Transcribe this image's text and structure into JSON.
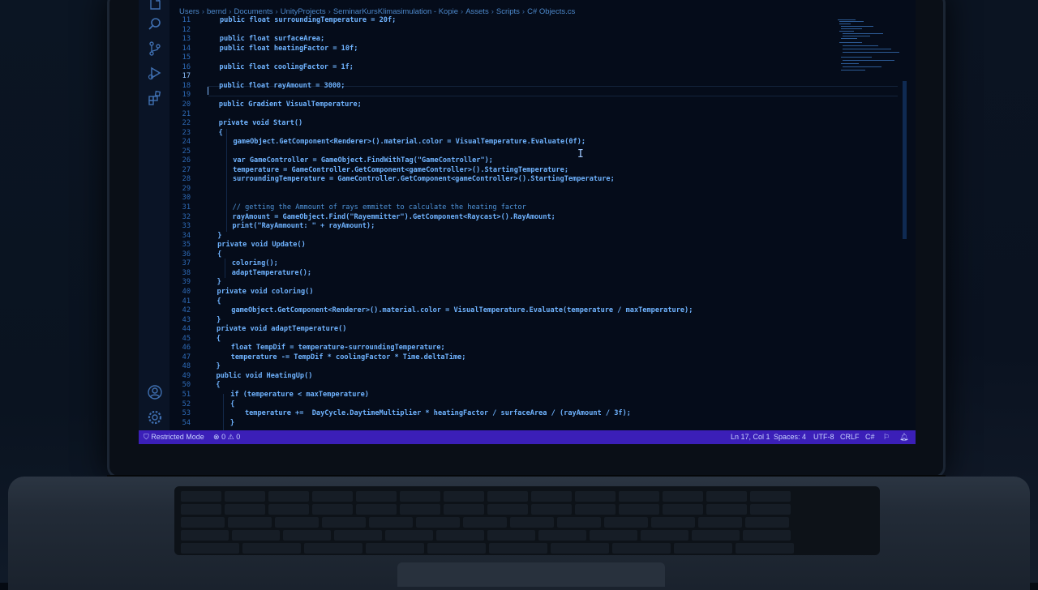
{
  "breadcrumb": [
    "Users",
    "bernd",
    "Documents",
    "UnityProjects",
    "SeminarKursKlimasimulation - Kopie",
    "Assets",
    "Scripts",
    "Objects.cs"
  ],
  "activity_bar": [
    "files-icon",
    "search-icon",
    "source-control-icon",
    "run-debug-icon",
    "extensions-icon",
    "account-icon",
    "settings-gear-icon"
  ],
  "code_lines": [
    {
      "n": "11",
      "indent": 0,
      "text": "public float surroundingTemperature = 20f;"
    },
    {
      "n": "12",
      "indent": 0,
      "text": ""
    },
    {
      "n": "13",
      "indent": 0,
      "text": "public float surfaceArea;"
    },
    {
      "n": "14",
      "indent": 0,
      "text": "public float heatingFactor = 10f;"
    },
    {
      "n": "15",
      "indent": 0,
      "text": ""
    },
    {
      "n": "16",
      "indent": 0,
      "text": "public float coolingFactor = 1f;"
    },
    {
      "n": "17",
      "indent": 0,
      "text": ""
    },
    {
      "n": "18",
      "indent": 0,
      "text": "public float rayAmount = 3000;"
    },
    {
      "n": "19",
      "indent": 0,
      "text": ""
    },
    {
      "n": "20",
      "indent": 0,
      "text": "public Gradient VisualTemperature;"
    },
    {
      "n": "21",
      "indent": 0,
      "text": ""
    },
    {
      "n": "22",
      "indent": 0,
      "text": "private void Start()"
    },
    {
      "n": "23",
      "indent": 0,
      "text": "{"
    },
    {
      "n": "24",
      "indent": 1,
      "text": "gameObject.GetComponent<Renderer>().material.color = VisualTemperature.Evaluate(0f);"
    },
    {
      "n": "25",
      "indent": 1,
      "text": ""
    },
    {
      "n": "26",
      "indent": 1,
      "text": "var GameController = GameObject.FindWithTag(\"GameController\");"
    },
    {
      "n": "27",
      "indent": 1,
      "text": "temperature = GameController.GetComponent<gameController>().StartingTemperature;"
    },
    {
      "n": "28",
      "indent": 1,
      "text": "surroundingTemperature = GameController.GetComponent<gameController>().StartingTemperature;"
    },
    {
      "n": "29",
      "indent": 1,
      "text": ""
    },
    {
      "n": "30",
      "indent": 1,
      "text": ""
    },
    {
      "n": "31",
      "indent": 1,
      "text": "// getting the Ammount of rays emmitet to calculate the heating factor"
    },
    {
      "n": "32",
      "indent": 1,
      "text": "rayAmount = GameObject.Find(\"Rayemmitter\").GetComponent<Raycast>().RayAmount;"
    },
    {
      "n": "33",
      "indent": 1,
      "text": "print(\"RayAmmount: \" + rayAmount);"
    },
    {
      "n": "34",
      "indent": 0,
      "text": "}"
    },
    {
      "n": "35",
      "indent": 0,
      "text": "private void Update()"
    },
    {
      "n": "36",
      "indent": 0,
      "text": "{"
    },
    {
      "n": "37",
      "indent": 1,
      "text": "coloring();"
    },
    {
      "n": "38",
      "indent": 1,
      "text": "adaptTemperature();"
    },
    {
      "n": "39",
      "indent": 0,
      "text": "}"
    },
    {
      "n": "40",
      "indent": 0,
      "text": "private void coloring()"
    },
    {
      "n": "41",
      "indent": 0,
      "text": "{"
    },
    {
      "n": "42",
      "indent": 1,
      "text": "gameObject.GetComponent<Renderer>().material.color = VisualTemperature.Evaluate(temperature / maxTemperature);"
    },
    {
      "n": "43",
      "indent": 0,
      "text": "}"
    },
    {
      "n": "44",
      "indent": 0,
      "text": "private void adaptTemperature()"
    },
    {
      "n": "45",
      "indent": 0,
      "text": "{"
    },
    {
      "n": "46",
      "indent": 1,
      "text": "float TempDif = temperature-surroundingTemperature;"
    },
    {
      "n": "47",
      "indent": 1,
      "text": "temperature -= TempDif * coolingFactor * Time.deltaTime;"
    },
    {
      "n": "48",
      "indent": 0,
      "text": "}"
    },
    {
      "n": "49",
      "indent": 0,
      "text": "public void HeatingUp()"
    },
    {
      "n": "50",
      "indent": 0,
      "text": "{"
    },
    {
      "n": "51",
      "indent": 1,
      "text": "if (temperature < maxTemperature)"
    },
    {
      "n": "52",
      "indent": 1,
      "text": "{"
    },
    {
      "n": "53",
      "indent": 2,
      "text": "temperature +=  DayCycle.DaytimeMultiplier * heatingFactor / surfaceArea / (rayAmount / 3f);"
    },
    {
      "n": "54",
      "indent": 1,
      "text": "}"
    }
  ],
  "current_line": "17",
  "status_bar": {
    "restricted_mode": "Restricted Mode",
    "errors": "0",
    "warnings": "0",
    "position": "Ln 17, Col 1",
    "spaces": "Spaces: 4",
    "encoding": "UTF-8",
    "eol": "CRLF",
    "language": "C#"
  },
  "colors": {
    "status_bar": "#3b1fb8",
    "editor_bg": "#050c1a",
    "code_text": "#6fb3ff",
    "line_numbers": "#2e6ab6"
  }
}
